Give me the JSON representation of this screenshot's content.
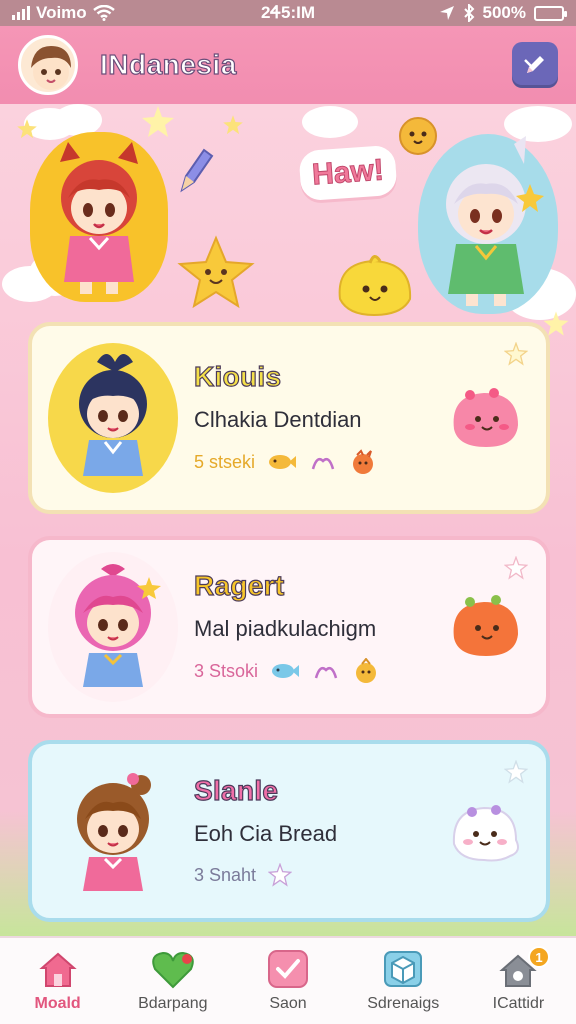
{
  "status_bar": {
    "carrier": "Voimo",
    "time": "2Ꮞ5:ΙM",
    "battery_text": "500%"
  },
  "header": {
    "title": "INdanesia",
    "action_icon": "edit-pencil-icon"
  },
  "hero": {
    "badge_text": "Haw!"
  },
  "cards": [
    {
      "name": "Kiouis",
      "name_color": "#f4e04a",
      "subtitle": "Clhakia Dentdian",
      "meta": "5 stseki",
      "meta_color": "#e5a92a",
      "portrait_bg": "#f7d84a"
    },
    {
      "name": "Ragert",
      "name_color": "#f7c62a",
      "subtitle": "Mal piadkulachigm",
      "meta": "3 Stsoki",
      "meta_color": "#d9669a",
      "portrait_bg": "#fff0f4"
    },
    {
      "name": "Slanle",
      "name_color": "#f06fa8",
      "subtitle": "Eoh Cia Bread",
      "meta": "3 Snaht",
      "meta_color": "#7b7b9a",
      "portrait_bg": "#e6f8fc"
    }
  ],
  "tabs": [
    {
      "label": "Moald",
      "icon": "home-icon",
      "active": true
    },
    {
      "label": "Bdarpang",
      "icon": "heart-icon",
      "active": false
    },
    {
      "label": "Saon",
      "icon": "check-heart-icon",
      "active": false
    },
    {
      "label": "Sdrenaigs",
      "icon": "box-icon",
      "active": false
    },
    {
      "label": "ICattidr",
      "icon": "house-gear-icon",
      "active": false,
      "badge": "1"
    }
  ]
}
